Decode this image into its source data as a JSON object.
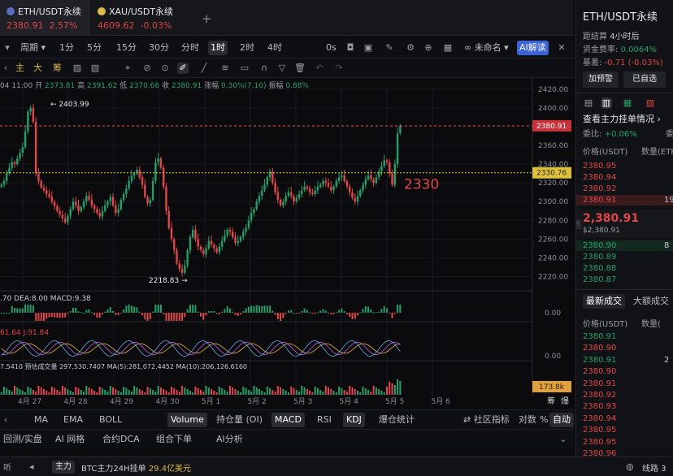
{
  "tabs": [
    {
      "symbol": "ETH/USDT永续",
      "price": "2380.91",
      "change": "2.57%"
    },
    {
      "symbol": "XAU/USDT永续",
      "price": "4609.62",
      "change": "-0.03%"
    }
  ],
  "toolbar": {
    "period_label": "周期",
    "intervals": [
      "1分",
      "5分",
      "15分",
      "30分",
      "分时",
      "1时",
      "2时",
      "4时"
    ],
    "active_interval": "1时",
    "seconds": "0s",
    "layout_name": "未命名",
    "ai_label": "AI解读"
  },
  "drawing_tools": [
    "主",
    "大",
    "筹"
  ],
  "ohlc_line": {
    "time": "04 11:00",
    "open_l": "开",
    "open": "2373.81",
    "high_l": "高",
    "high": "2391.62",
    "low_l": "低",
    "low": "2370.66",
    "close_l": "收",
    "close": "2380.91",
    "chg_l": "涨幅",
    "chg": "0.30%(7.10)",
    "amp_l": "振幅",
    "amp": "0.88%"
  },
  "chart": {
    "price_ticks": [
      "2420.00",
      "2400.00",
      "2380.00",
      "2360.00",
      "2340.00",
      "2320.00",
      "2300.00",
      "2280.00",
      "2260.00",
      "2240.00",
      "2220.00"
    ],
    "current_price": "2380.91",
    "line_price": "2330.76",
    "annotation": "2330",
    "high_marker": "2403.99",
    "low_marker": "2218.83",
    "date_ticks": [
      "4月 27",
      "4月 28",
      "4月 29",
      "4月 30",
      "5月 1",
      "5月 2",
      "5月 3",
      "5月 4",
      "5月 5",
      "5月 6"
    ],
    "macd_text": {
      "a": ".70",
      "dea_l": "DEA:",
      "dea": "8.00",
      "macd_l": "MACD:",
      "macd": "9.38",
      "zero": "0.00"
    },
    "kdj_text": {
      "a": "61.64",
      "j_l": "J:",
      "j": "91.84",
      "zero": "0.00"
    },
    "vol_text": {
      "a": "7.5410",
      "pred_l": "预估成交量",
      "pred": "297,530.7407",
      "ma5_l": "MA(5):",
      "ma5": "281,072.4452",
      "ma10_l": "MA(10):",
      "ma10": "206,126.6160",
      "vol_badge": "173.8k"
    },
    "corner": [
      "筹",
      "爆"
    ]
  },
  "chart_data": {
    "type": "candlestick",
    "interval": "1时",
    "ylim": [
      2210,
      2425
    ],
    "series": [
      {
        "name": "ETH/USDT永续",
        "closes": [
          2318,
          2322,
          2330,
          2336,
          2342,
          2340,
          2346,
          2352,
          2358,
          2375,
          2396,
          2400,
          2385,
          2330,
          2322,
          2315,
          2312,
          2308,
          2305,
          2300,
          2295,
          2290,
          2286,
          2282,
          2278,
          2285,
          2292,
          2300,
          2296,
          2290,
          2294,
          2300,
          2306,
          2302,
          2296,
          2292,
          2288,
          2284,
          2290,
          2296,
          2300,
          2305,
          2296,
          2288,
          2292,
          2302,
          2308,
          2314,
          2322,
          2328,
          2330,
          2334,
          2326,
          2318,
          2305,
          2298,
          2302,
          2322,
          2342,
          2346,
          2336,
          2316,
          2290,
          2272,
          2260,
          2248,
          2234,
          2228,
          2224,
          2232,
          2248,
          2262,
          2270,
          2260,
          2252,
          2248,
          2244,
          2250,
          2258,
          2254,
          2250,
          2246,
          2252,
          2258,
          2264,
          2270,
          2268,
          2262,
          2256,
          2258,
          2262,
          2268,
          2272,
          2280,
          2288,
          2292,
          2300,
          2306,
          2312,
          2318,
          2326,
          2332,
          2320,
          2310,
          2302,
          2296,
          2300,
          2306,
          2310,
          2306,
          2300,
          2304,
          2308,
          2312,
          2316,
          2314,
          2310,
          2308,
          2312,
          2316,
          2318,
          2322,
          2320,
          2316,
          2312,
          2316,
          2322,
          2326,
          2328,
          2322,
          2316,
          2310,
          2304,
          2300,
          2306,
          2312,
          2318,
          2324,
          2328,
          2324,
          2320,
          2326,
          2332,
          2338,
          2344,
          2342,
          2330,
          2318,
          2340,
          2373,
          2380.91
        ]
      }
    ],
    "markers": [
      {
        "label": "2403.99"
      },
      {
        "label": "2218.83"
      }
    ]
  },
  "right_panel": {
    "title": "ETH/USDT永续",
    "settle_l": "距结算",
    "settle": "4小时后",
    "fund_l": "资金费率:",
    "fund": "0.0064%",
    "basis_l": "基差:",
    "basis": "-0.71 (-0.03%)",
    "btn_alert": "加预警",
    "btn_fav": "已自选",
    "book_title": "查看主力挂单情况",
    "ratio_l": "委比:",
    "ratio": "+0.06%",
    "ratio2": "委",
    "col_price": "价格(USDT)",
    "col_qty": "数量(ETH",
    "asks": [
      "2380.95",
      "2380.94",
      "2380.92",
      "2380.91"
    ],
    "ask_qty_last": "19",
    "last": "2,380.91",
    "last_sub": "$2,380.91",
    "bids": [
      "2380.90",
      "2380.89",
      "2380.88",
      "2380.87"
    ],
    "bid_qty_first": "8",
    "trades_tab": "最新成交",
    "big_tab": "大额成交",
    "t_col_price": "价格(USDT)",
    "t_col_qty": "数量(",
    "trades": [
      [
        "2380.91",
        "dn"
      ],
      [
        "2380.90",
        "up"
      ],
      [
        "2380.91",
        "dn"
      ],
      [
        "2380.90",
        "up"
      ],
      [
        "2380.91",
        "up"
      ],
      [
        "2380.92",
        "up"
      ],
      [
        "2380.93",
        "up"
      ],
      [
        "2380.94",
        "up"
      ],
      [
        "2380.95",
        "up"
      ],
      [
        "2380.95",
        "up"
      ],
      [
        "2380.96",
        "up"
      ]
    ],
    "trade_qty": "2"
  },
  "bottom": {
    "indicators": [
      "MA",
      "EMA",
      "BOLL",
      "Volume",
      "持仓量 (OI)",
      "MACD",
      "RSI",
      "KDJ",
      "爆仓统计"
    ],
    "active": [
      "Volume",
      "MACD",
      "KDJ"
    ],
    "community": "社区指标",
    "log": "对数",
    "pct": "%",
    "auto": "自动"
  },
  "tools": {
    "items": [
      "回测/实盘",
      "AI 网格",
      "合约DCA",
      "组合下单",
      "AI分析"
    ]
  },
  "status": {
    "tag": "主力",
    "text": "BTC主力24H挂单",
    "value": "29.4亿美元",
    "right": "线路 3"
  }
}
